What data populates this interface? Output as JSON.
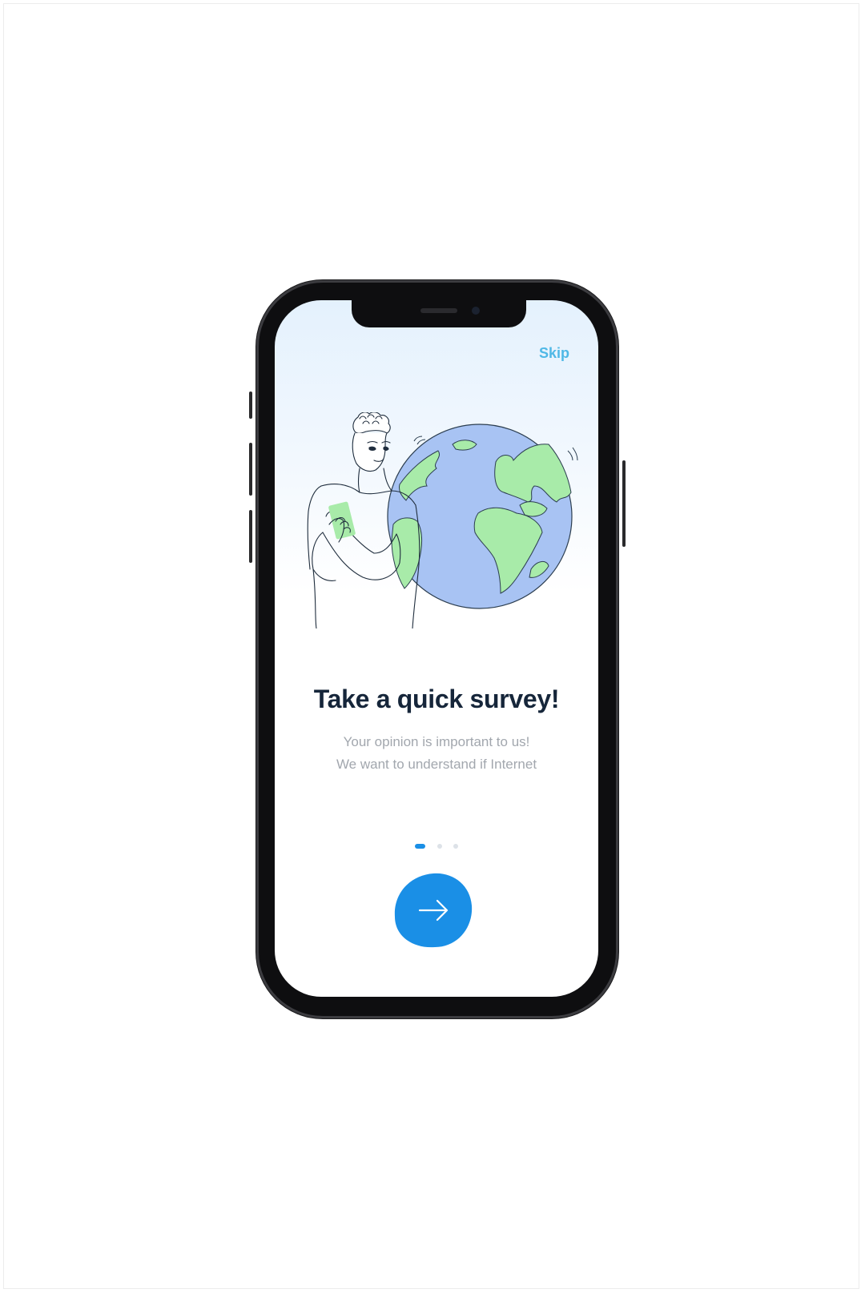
{
  "onboarding": {
    "skip_label": "Skip",
    "title": "Take a quick survey!",
    "subtitle_line1": "Your opinion is important to us!",
    "subtitle_line2": "We want to understand if Internet",
    "pagination": {
      "total": 3,
      "current": 1
    }
  },
  "icons": {
    "next": "arrow-right-icon",
    "illustration": "person-with-globe-illustration"
  },
  "colors": {
    "accent": "#1a8fe6",
    "skip": "#4fb8e6",
    "title": "#16263a",
    "subtitle": "#a2a7ae",
    "globe_ocean": "#a8c3f3",
    "globe_land": "#a8eba9"
  }
}
